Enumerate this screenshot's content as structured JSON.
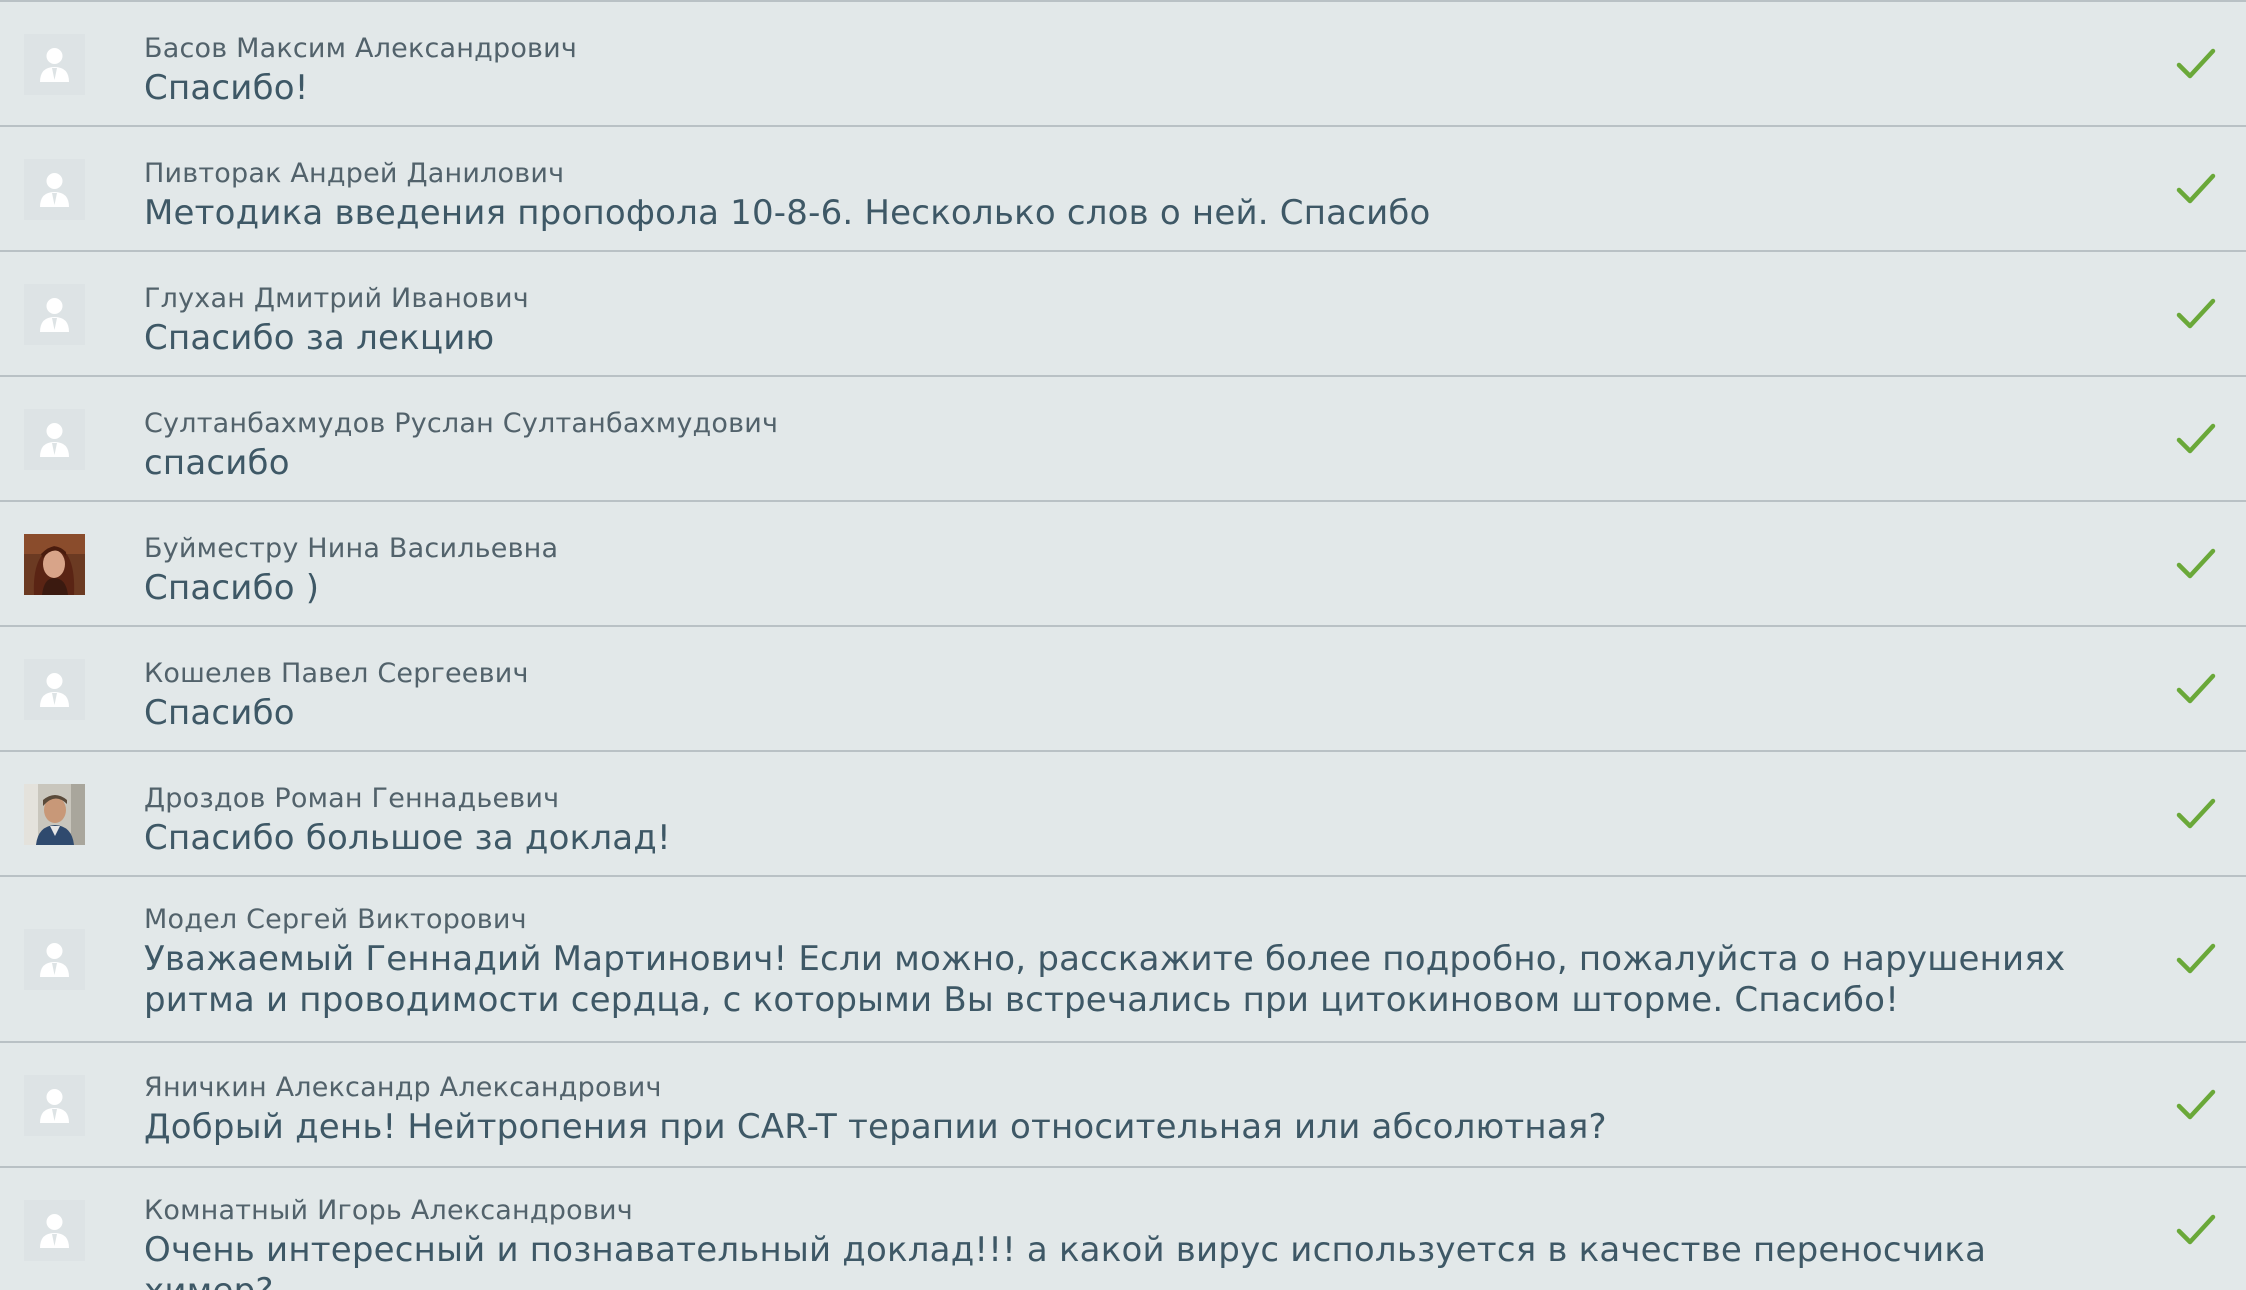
{
  "theme": {
    "background": "#e2e8e9",
    "separator": "#b9c1c5",
    "author_color": "#52626b",
    "message_color": "#3e5866",
    "check_color": "#6aa839"
  },
  "questions": [
    {
      "author": "Басов Максим Александрович",
      "message": "Спасибо!",
      "avatar": "default-user-icon",
      "status": "checkmark-icon"
    },
    {
      "author": "Пивторак Андрей Данилович",
      "message": "Методика введения пропофола 10-8-6. Несколько слов о ней. Спасибо",
      "avatar": "default-user-icon",
      "status": "checkmark-icon"
    },
    {
      "author": "Глухан Дмитрий Иванович",
      "message": "Спасибо за лекцию",
      "avatar": "default-user-icon",
      "status": "checkmark-icon"
    },
    {
      "author": "Султанбахмудов Руслан Султанбахмудович",
      "message": "спасибо",
      "avatar": "default-user-icon",
      "status": "checkmark-icon"
    },
    {
      "author": "Буйместру Нина Васильевна",
      "message": "Спасибо )",
      "avatar": "user-photo-woman",
      "status": "checkmark-icon"
    },
    {
      "author": "Кошелев Павел Сергеевич",
      "message": "Спасибо",
      "avatar": "default-user-icon",
      "status": "checkmark-icon"
    },
    {
      "author": "Дроздов Роман Геннадьевич",
      "message": "Спасибо большое за доклад!",
      "avatar": "user-photo-man",
      "status": "checkmark-icon"
    },
    {
      "author": "Модел Сергей Викторович",
      "message": "Уважаемый Геннадий Мартинович! Если можно, расскажите более подробно, пожалуйста о нарушениях ритма и проводимости сердца, с которыми Вы встречались при цитокиновом шторме. Спасибо!",
      "avatar": "default-user-icon",
      "status": "checkmark-icon"
    },
    {
      "author": "Яничкин Александр Александрович",
      "message": "Добрый день! Нейтропения при CAR-T терапии относительная или абсолютная?",
      "avatar": "default-user-icon",
      "status": "checkmark-icon"
    },
    {
      "author": "Комнатный Игорь Александрович",
      "message": "Очень интересный и познавательный доклад!!! а какой вирус используется в качестве переносчика химер?",
      "avatar": "default-user-icon",
      "status": "checkmark-icon"
    }
  ]
}
